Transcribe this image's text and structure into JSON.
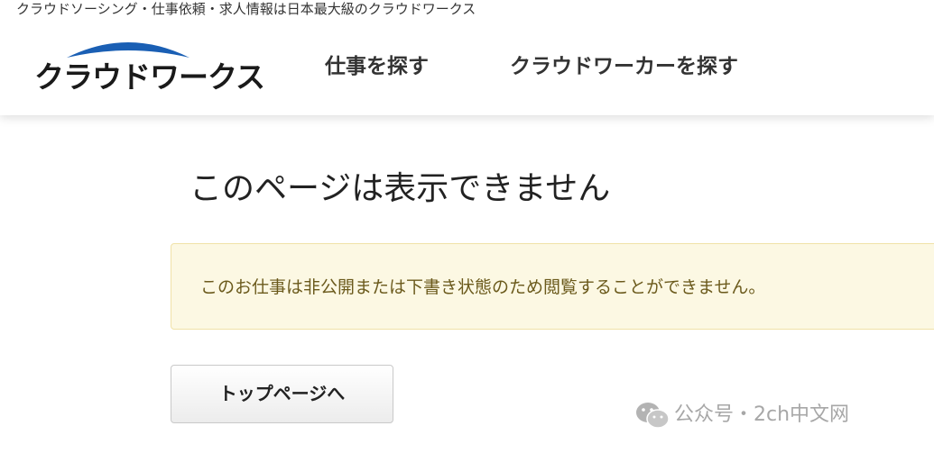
{
  "header": {
    "tagline": "クラウドソーシング・仕事依頼・求人情報は日本最大級のクラウドワークス",
    "logo_text": "クラウドワークス",
    "logo_arc_color": "#1a5fb4",
    "nav": [
      {
        "label": "仕事を探す"
      },
      {
        "label": "クラウドワーカーを探す"
      }
    ]
  },
  "main": {
    "title": "このページは表示できません",
    "notice": "このお仕事は非公開または下書き状態のため閲覧することができません。",
    "notice_bg": "#fcf8e3",
    "top_button_label": "トップページへ"
  },
  "watermark": {
    "icon": "wechat-icon",
    "text": "公众号・2ch中文网"
  }
}
